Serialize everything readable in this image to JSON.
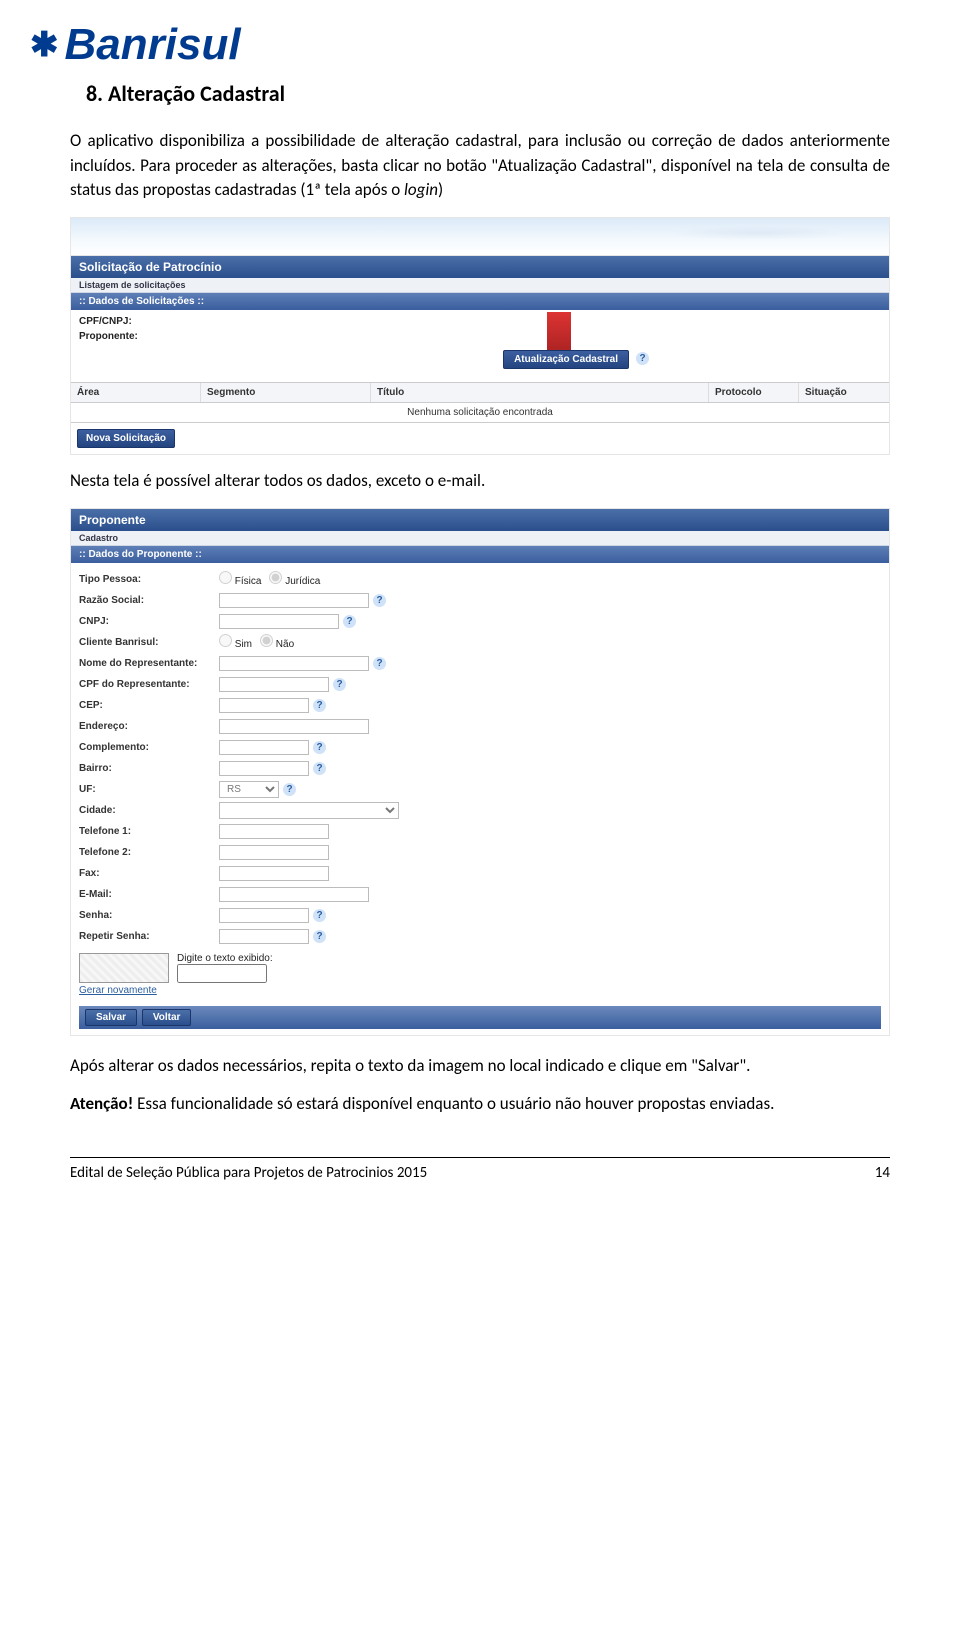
{
  "logo_text": "Banrisul",
  "heading": "8. Alteração Cadastral",
  "para1": "O aplicativo disponibiliza a possibilidade de alteração cadastral, para inclusão ou correção de dados anteriormente incluídos. Para proceder as alterações, basta clicar no botão \"Atualização Cadastral\", disponível na tela de consulta de status das propostas cadastradas (1ª tela após o ",
  "para1_login": "login",
  "para1_end": ")",
  "shot1": {
    "title": "Solicitação de Patrocínio",
    "subtitle": "Listagem de solicitações",
    "section": ":: Dados de Solicitações ::",
    "cpf_label": "CPF/CNPJ:",
    "cpf_val": "",
    "prop_label": "Proponente:",
    "prop_val": "",
    "btn_atual": "Atualização Cadastral",
    "col_area": "Área",
    "col_seg": "Segmento",
    "col_tit": "Título",
    "col_prot": "Protocolo",
    "col_sit": "Situação",
    "empty": "Nenhuma solicitação encontrada",
    "btn_nova": "Nova Solicitação"
  },
  "para2": "Nesta tela é possível alterar todos os dados, exceto o e-mail.",
  "shot2": {
    "title": "Proponente",
    "subtitle": "Cadastro",
    "section": ":: Dados do Proponente ::",
    "tipo_label": "Tipo Pessoa:",
    "tipo_fisica": "Física",
    "tipo_juridica": "Jurídica",
    "razao_label": "Razão Social:",
    "cnpj_label": "CNPJ:",
    "cliente_label": "Cliente Banrisul:",
    "cliente_sim": "Sim",
    "cliente_nao": "Não",
    "nome_rep_label": "Nome do Representante:",
    "cpf_rep_label": "CPF do Representante:",
    "cep_label": "CEP:",
    "end_label": "Endereço:",
    "compl_label": "Complemento:",
    "bairro_label": "Bairro:",
    "uf_label": "UF:",
    "uf_val": "RS",
    "cidade_label": "Cidade:",
    "tel1_label": "Telefone 1:",
    "tel2_label": "Telefone 2:",
    "fax_label": "Fax:",
    "email_label": "E-Mail:",
    "senha_label": "Senha:",
    "rep_senha_label": "Repetir Senha:",
    "captcha_label": "Digite o texto exibido:",
    "gerar": "Gerar novamente",
    "btn_salvar": "Salvar",
    "btn_voltar": "Voltar"
  },
  "para3": "Após alterar os dados necessários, repita o texto da imagem no local indicado e clique em \"Salvar\".",
  "para4_label": "Atenção!",
  "para4_rest": " Essa funcionalidade só estará disponível enquanto o usuário não houver propostas enviadas.",
  "footer_text": "Edital de Seleção Pública para Projetos de Patrocinios 2015",
  "footer_page": "14"
}
